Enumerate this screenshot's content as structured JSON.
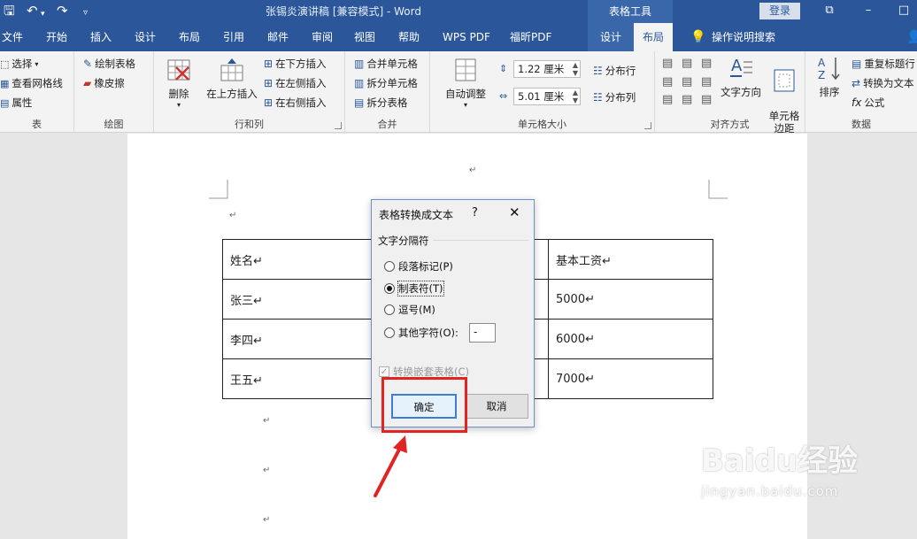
{
  "titlebar": {
    "title": "张锡炎演讲稿 [兼容模式] - Word",
    "context_tab": "表格工具",
    "login": "登录"
  },
  "tabs": [
    "文件",
    "开始",
    "插入",
    "设计",
    "布局",
    "引用",
    "邮件",
    "审阅",
    "视图",
    "帮助",
    "WPS PDF",
    "福昕PDF",
    "设计",
    "布局"
  ],
  "tell_me": "操作说明搜索",
  "ribbon": {
    "table": {
      "label": "表",
      "select": "选择",
      "gridlines": "查看网格线",
      "properties": "属性"
    },
    "draw": {
      "label": "绘图",
      "draw_table": "绘制表格",
      "eraser": "橡皮擦"
    },
    "rows_cols": {
      "label": "行和列",
      "delete": "删除",
      "insert_above": "在上方插入",
      "insert_below": "在下方插入",
      "insert_left": "在左侧插入",
      "insert_right": "在右侧插入"
    },
    "merge": {
      "label": "合并",
      "merge_cells": "合并单元格",
      "split_cells": "拆分单元格",
      "split_table": "拆分表格"
    },
    "cell_size": {
      "label": "单元格大小",
      "autofit": "自动调整",
      "height": "1.22 厘米",
      "width": "5.01 厘米",
      "dist_rows": "分布行",
      "dist_cols": "分布列"
    },
    "align": {
      "label": "对齐方式",
      "text_direction": "文字方向",
      "cell_margins": "单元格\n边距"
    },
    "data": {
      "label": "数据",
      "sort": "排序",
      "repeat_header": "重复标题行",
      "convert": "转换为文本",
      "formula": "公式"
    }
  },
  "table": {
    "rows": [
      [
        "姓名↵",
        "基本工资↵"
      ],
      [
        "张三↵",
        "5000↵"
      ],
      [
        "李四↵",
        "6000↵"
      ],
      [
        "王五↵",
        "7000↵"
      ]
    ]
  },
  "dialog": {
    "title": "表格转换成文本",
    "help": "?",
    "section": "文字分隔符",
    "options": [
      "段落标记(P)",
      "制表符(T)",
      "逗号(M)",
      "其他字符(O):"
    ],
    "selected_index": 1,
    "other_value": "-",
    "nested_checkbox": "转换嵌套表格(C)",
    "ok": "确定",
    "cancel": "取消"
  },
  "watermark": {
    "brand": "Baidu经验",
    "url": "jingyan.baidu.com"
  }
}
